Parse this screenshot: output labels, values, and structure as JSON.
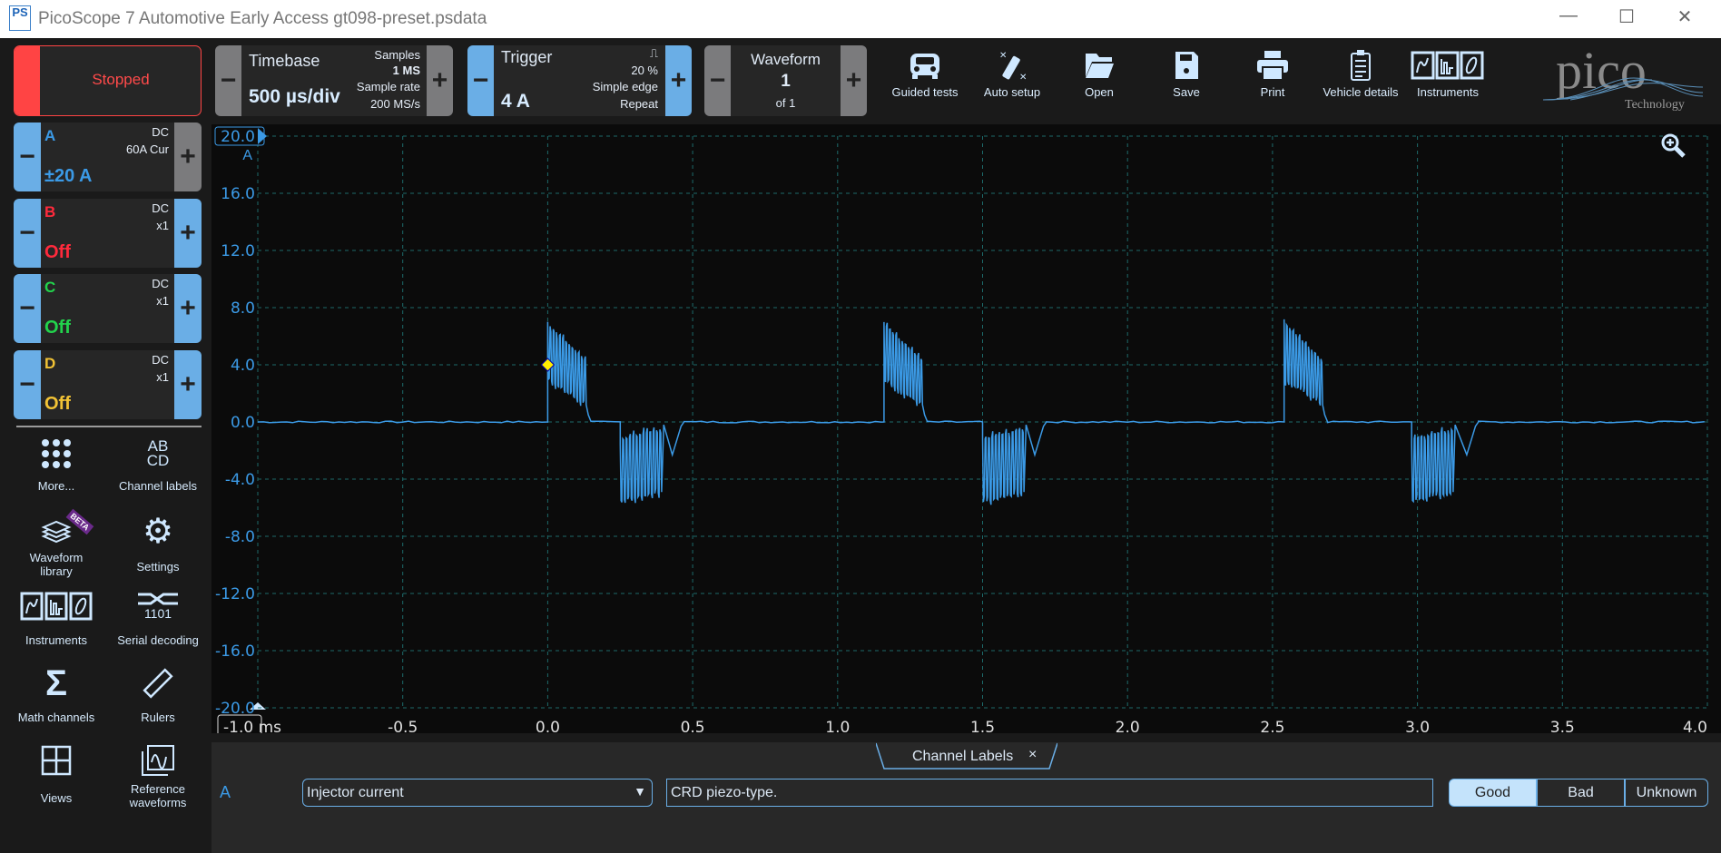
{
  "window": {
    "title": "PicoScope 7 Automotive Early Access gt098-preset.psdata",
    "app_icon_text": "PS",
    "minimize": "—",
    "maximize": "☐",
    "close": "✕"
  },
  "run": {
    "label": "Stopped",
    "color": "#ff4444"
  },
  "timebase": {
    "title": "Timebase",
    "value": "500 µs/div",
    "samples_label": "Samples",
    "samples": "1 MS",
    "rate_label": "Sample rate",
    "rate": "200 MS/s",
    "minus": "−",
    "plus": "+"
  },
  "trigger": {
    "title": "Trigger",
    "level": "4 A",
    "edge_symbol": "⎍",
    "pretrigger": "20 %",
    "type": "Simple edge",
    "mode": "Repeat",
    "minus": "−",
    "plus": "+"
  },
  "waveform": {
    "title": "Waveform",
    "index": "1",
    "of": "of 1",
    "minus": "−",
    "plus": "+"
  },
  "toolbar": [
    {
      "label": "Guided tests",
      "icon": "car-icon"
    },
    {
      "label": "Auto setup",
      "icon": "magic-wand-icon"
    },
    {
      "label": "Open",
      "icon": "folder-icon"
    },
    {
      "label": "Save",
      "icon": "save-icon"
    },
    {
      "label": "Print",
      "icon": "printer-icon"
    },
    {
      "label": "Vehicle details",
      "icon": "clipboard-icon"
    },
    {
      "label": "Instruments",
      "icon": "instruments-icon"
    }
  ],
  "brand": {
    "name": "pico",
    "sub": "Technology"
  },
  "channels": [
    {
      "name": "A",
      "coupling": "DC",
      "probe": "60A Cur",
      "range": "±20 A",
      "color": "#3b9ae6"
    },
    {
      "name": "B",
      "coupling": "DC",
      "probe": "x1",
      "range": "Off",
      "color": "#ff2a3c"
    },
    {
      "name": "C",
      "coupling": "DC",
      "probe": "x1",
      "range": "Off",
      "color": "#22d34c"
    },
    {
      "name": "D",
      "coupling": "DC",
      "probe": "x1",
      "range": "Off",
      "color": "#f2c335"
    }
  ],
  "sidebar": [
    {
      "label": "More...",
      "icon": "dots-grid-icon"
    },
    {
      "label": "Channel labels",
      "icon": "abcd-icon",
      "glyph": "AB\nCD"
    },
    {
      "label": "Waveform library",
      "icon": "waveform-library-icon",
      "badge": "BETA"
    },
    {
      "label": "Settings",
      "icon": "gear-icon"
    },
    {
      "label": "Instruments",
      "icon": "instruments-icon"
    },
    {
      "label": "Serial decoding",
      "icon": "serial-decoding-icon",
      "glyph": "1101"
    },
    {
      "label": "Math channels",
      "icon": "sigma-icon",
      "glyph": "Σ"
    },
    {
      "label": "Rulers",
      "icon": "ruler-icon"
    },
    {
      "label": "Views",
      "icon": "views-grid-icon"
    },
    {
      "label": "Reference waveforms",
      "icon": "reference-waveform-icon"
    }
  ],
  "chart_data": {
    "type": "line",
    "xlabel": "ms",
    "ylabel": "A",
    "xlim": [
      -1.0,
      4.0
    ],
    "ylim": [
      -20.0,
      20.0
    ],
    "xticks": [
      "-1.0",
      "-0.5",
      "0.0",
      "0.5",
      "1.0",
      "1.5",
      "2.0",
      "2.5",
      "3.0",
      "3.5",
      "4.0"
    ],
    "yticks": [
      "20.0",
      "16.0",
      "12.0",
      "8.0",
      "4.0",
      "0.0",
      "-4.0",
      "-8.0",
      "-12.0",
      "-16.0",
      "-20.0"
    ],
    "grid": true,
    "series": [
      {
        "channel": "A",
        "color": "#3b9ae6",
        "baseline": 0.0,
        "bursts": [
          {
            "start": 0.0,
            "end": 0.13,
            "upper": [
              6.8,
              4.3
            ],
            "lower": [
              3.0,
              1.2
            ]
          },
          {
            "start": 0.25,
            "end": 0.39,
            "upper": [
              -1.2,
              -0.5
            ],
            "lower": [
              -5.5,
              -4.9
            ],
            "undershoot_t": 0.43,
            "undershoot_v": -2.3,
            "settle": 0.47
          },
          {
            "start": 1.16,
            "end": 1.29,
            "upper": [
              6.8,
              4.3
            ],
            "lower": [
              3.0,
              1.2
            ]
          },
          {
            "start": 1.5,
            "end": 1.64,
            "upper": [
              -1.2,
              -0.5
            ],
            "lower": [
              -5.6,
              -4.9
            ],
            "undershoot_t": 1.68,
            "undershoot_v": -2.3,
            "settle": 1.72
          },
          {
            "start": 2.54,
            "end": 2.67,
            "upper": [
              6.9,
              4.3
            ],
            "lower": [
              3.0,
              1.2
            ]
          },
          {
            "start": 2.98,
            "end": 3.12,
            "upper": [
              -1.2,
              -0.5
            ],
            "lower": [
              -5.5,
              -4.9
            ],
            "undershoot_t": 3.17,
            "undershoot_v": -2.3,
            "settle": 3.21
          }
        ]
      }
    ],
    "trigger_marker": {
      "t": 0.0,
      "v": 4.0,
      "color": "#ffee00"
    }
  },
  "bottom": {
    "tab": "Channel Labels",
    "tab_close": "×",
    "channel": "A",
    "label_select": "Injector current",
    "note": "CRD piezo-type.",
    "ratings": [
      "Good",
      "Bad",
      "Unknown"
    ],
    "selected_rating": "Good"
  }
}
